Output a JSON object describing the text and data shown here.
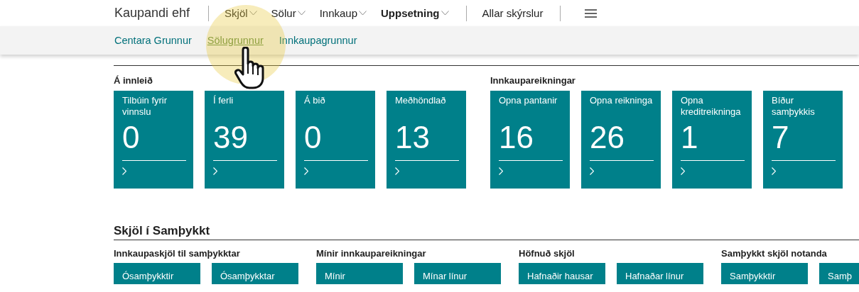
{
  "header": {
    "company": "Kaupandi ehf",
    "nav": [
      {
        "label": "Skjöl",
        "selected": false,
        "has_menu": true
      },
      {
        "label": "Sölur",
        "selected": false,
        "has_menu": true
      },
      {
        "label": "Innkaup",
        "selected": false,
        "has_menu": true
      },
      {
        "label": "Uppsetning",
        "selected": true,
        "has_menu": true
      },
      {
        "label": "Allar skýrslur",
        "selected": false,
        "has_menu": false
      }
    ]
  },
  "subnav": [
    {
      "label": "Centara Grunnur",
      "hovered": false
    },
    {
      "label": "Sölugrunnur",
      "hovered": true
    },
    {
      "label": "Innkaupagrunnur",
      "hovered": false
    }
  ],
  "cue_groups": [
    {
      "title": "Á innleið",
      "tiles": [
        {
          "label": "Tilbúin fyrir vinnslu",
          "value": "0"
        },
        {
          "label": "Í ferli",
          "value": "39"
        },
        {
          "label": "Á bið",
          "value": "0"
        },
        {
          "label": "Meðhöndlað",
          "value": "13"
        }
      ]
    },
    {
      "title": "Innkaupareikningar",
      "tiles": [
        {
          "label": "Opna pantanir",
          "value": "16"
        },
        {
          "label": "Opna reikninga",
          "value": "26"
        },
        {
          "label": "Opna kreditreikninga",
          "value": "1"
        },
        {
          "label": "Bíður samþykkis",
          "value": "7"
        }
      ]
    }
  ],
  "approval": {
    "title": "Skjöl í Samþykkt",
    "groups": [
      {
        "title": "Innkaupaskjöl til samþykktar",
        "actions": [
          "Ósamþykktir",
          "Ósamþykktar"
        ]
      },
      {
        "title": "Mínir innkaupareikningar",
        "actions": [
          "Mínir",
          "Mínar línur"
        ]
      },
      {
        "title": "Höfnuð skjöl",
        "actions": [
          "Hafnaðir hausar",
          "Hafnaðar línur"
        ]
      },
      {
        "title": "Samþykkt skjöl notanda",
        "actions": [
          "Samþykktir",
          "Samþ"
        ]
      }
    ]
  }
}
